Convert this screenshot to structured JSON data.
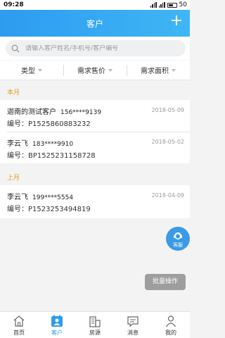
{
  "status": {
    "time": "09:28",
    "battery": "50"
  },
  "header": {
    "title": "客户",
    "add_icon": "plus-icon"
  },
  "search": {
    "placeholder": "请输入客户姓名/手机号/客户编号"
  },
  "filters": [
    {
      "label": "类型"
    },
    {
      "label": "需求售价"
    },
    {
      "label": "需求面积"
    }
  ],
  "sections": [
    {
      "label": "本月",
      "customers": [
        {
          "name": "迦南的测试客户",
          "phone": "156****9139",
          "date": "2018-05-09",
          "code": "编号：P1525860883232"
        },
        {
          "name": "李云飞",
          "phone": "183****9910",
          "date": "2018-05-02",
          "code": "编号：BP1525231158728"
        }
      ]
    },
    {
      "label": "上月",
      "customers": [
        {
          "name": "李云飞",
          "phone": "199****5554",
          "date": "2018-04-09",
          "code": "编号：P1523253494819"
        }
      ]
    }
  ],
  "float": {
    "service_label": "客服",
    "batch_label": "批量操作"
  },
  "tabs": [
    {
      "label": "首页",
      "icon": "home-icon"
    },
    {
      "label": "客户",
      "icon": "customer-icon",
      "active": true
    },
    {
      "label": "房源",
      "icon": "building-icon"
    },
    {
      "label": "消息",
      "icon": "message-icon"
    },
    {
      "label": "我的",
      "icon": "person-icon"
    }
  ],
  "colors": {
    "brand": "#2d9bf0",
    "section": "#e39b1c",
    "batch": "#9e9e9e"
  }
}
